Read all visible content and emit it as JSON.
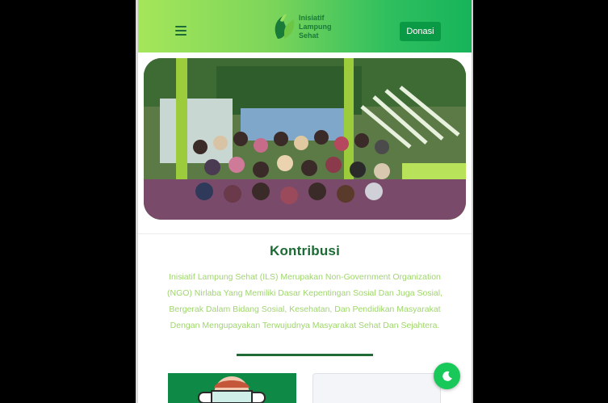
{
  "navbar": {
    "menu_icon": "hamburger-icon",
    "brand": {
      "logo_icon": "leaf-logo-icon",
      "line1": "Inisiatif",
      "line2": "Lampung",
      "line3": "Sehat"
    },
    "donate_label": "Donasi"
  },
  "hero": {
    "image": "group-photo"
  },
  "section": {
    "title": "Kontribusi",
    "body": "Inisiatif Lampung Sehat (ILS) Merupakan Non-Government Organization (NGO) Nirlaba Yang Memiliki Dasar Kepentingan Sosial Dan Juga Sosial, Bergerak Dalam Bidang Sosial, Kesehatan, Dan Pendidikan Masyarakat Dengan Mengupayakan Terwujudnya Masyarakat Sehat Dan Sejahtera."
  },
  "dark_mode_toggle": {
    "icon": "moon-icon"
  },
  "colors": {
    "primary": "#0a9a46",
    "title": "#1c6a34",
    "body_text": "#9fd66c",
    "toggle": "#18c95a"
  }
}
